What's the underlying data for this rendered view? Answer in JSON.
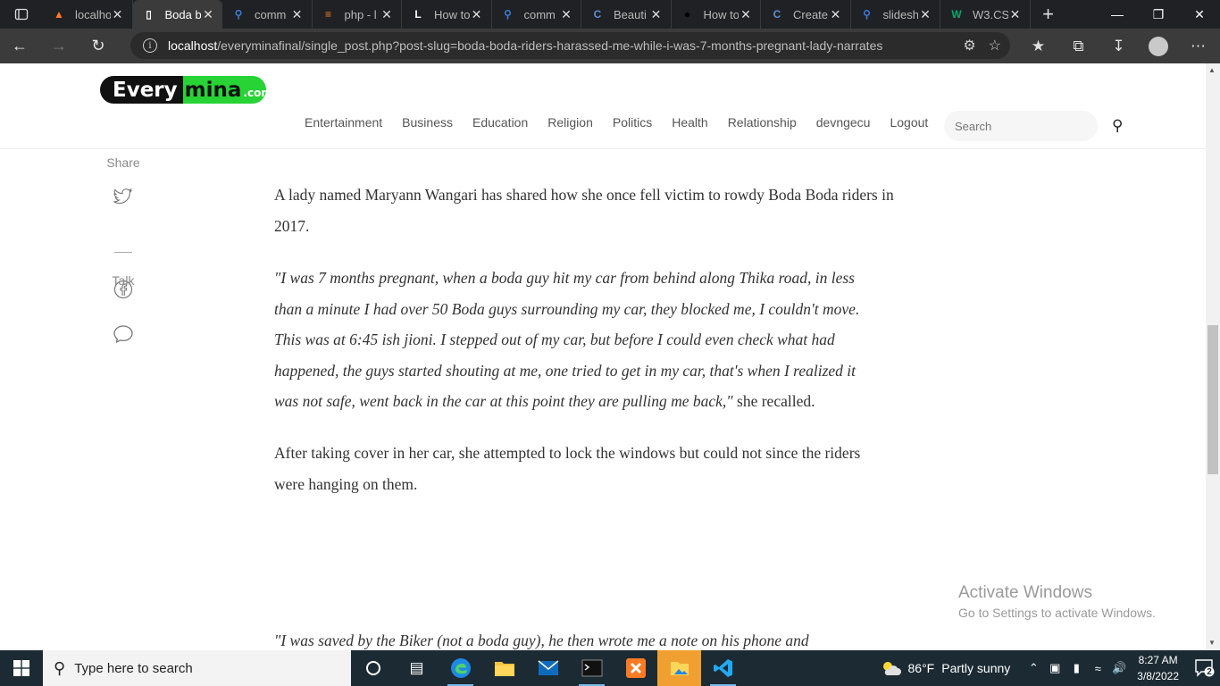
{
  "browser": {
    "tabs": [
      {
        "title": "localhost",
        "icon": "xampp-icon",
        "icon_color": "#fb7a24"
      },
      {
        "title": "Boda b",
        "icon": "page-icon",
        "icon_color": "#ffffff",
        "active": true
      },
      {
        "title": "comm",
        "icon": "search-icon",
        "icon_color": "#3b7bd6"
      },
      {
        "title": "php - l",
        "icon": "stackoverflow-icon",
        "icon_color": "#f48024"
      },
      {
        "title": "How to",
        "icon": "letter-l-icon",
        "icon_color": "#ffffff"
      },
      {
        "title": "comm",
        "icon": "search-icon",
        "icon_color": "#3b7bd6"
      },
      {
        "title": "Beauti",
        "icon": "c-logo-icon",
        "icon_color": "#5b8fd6"
      },
      {
        "title": "How to",
        "icon": "github-icon",
        "icon_color": "#000000"
      },
      {
        "title": "Create",
        "icon": "c-logo-icon",
        "icon_color": "#5b8fd6"
      },
      {
        "title": "slidesh",
        "icon": "search-icon",
        "icon_color": "#3b7bd6"
      },
      {
        "title": "W3.CS",
        "icon": "w3schools-icon",
        "icon_color": "#04aa6d"
      }
    ],
    "url_host": "localhost",
    "url_path": "/everyminafinal/single_post.php?post-slug=boda-boda-riders-harassed-me-while-i-was-7-months-pregnant-lady-narrates"
  },
  "site": {
    "logo_part1": "Every",
    "logo_part2": "mina",
    "logo_suffix": ".com",
    "nav": [
      "Entertainment",
      "Business",
      "Education",
      "Religion",
      "Politics",
      "Health",
      "Relationship",
      "devngecu",
      "Logout"
    ],
    "search_placeholder": "Search"
  },
  "sidebar": {
    "share_label": "Share",
    "talk_label": "Talk"
  },
  "article": {
    "p1": "A lady named Maryann Wangari has shared how she once fell victim to rowdy Boda Boda riders in 2017.",
    "quote1_lines": [
      "\"I was 7 months pregnant, when a boda guy hit my car from behind along Thika road, in less",
      "than a minute I had over 50 Boda guys surrounding my car, they blocked me, I couldn't move.",
      "This was at 6:45 ish jioni. I stepped out of my car, but before I could even check what had",
      "happened, the guys started shouting at me, one tried to get in my car, that's when I realized it",
      "was not safe, went back in the car at this point they are pulling me back,\""
    ],
    "quote1_tail": " she recalled.",
    "p2_lines": [
      "After taking cover in her car, she attempted to lock the windows but could not since the riders",
      "were hanging on them."
    ],
    "quote2_partial": "\"I was saved by the Biker (not a boda guy), he then wrote me a note on his phone and"
  },
  "watermark": {
    "line1": "Activate Windows",
    "line2": "Go to Settings to activate Windows."
  },
  "taskbar": {
    "search_placeholder": "Type here to search",
    "weather_temp": "86°F",
    "weather_desc": "Partly sunny",
    "time": "8:27 AM",
    "date": "3/8/2022",
    "notification_count": "2"
  }
}
